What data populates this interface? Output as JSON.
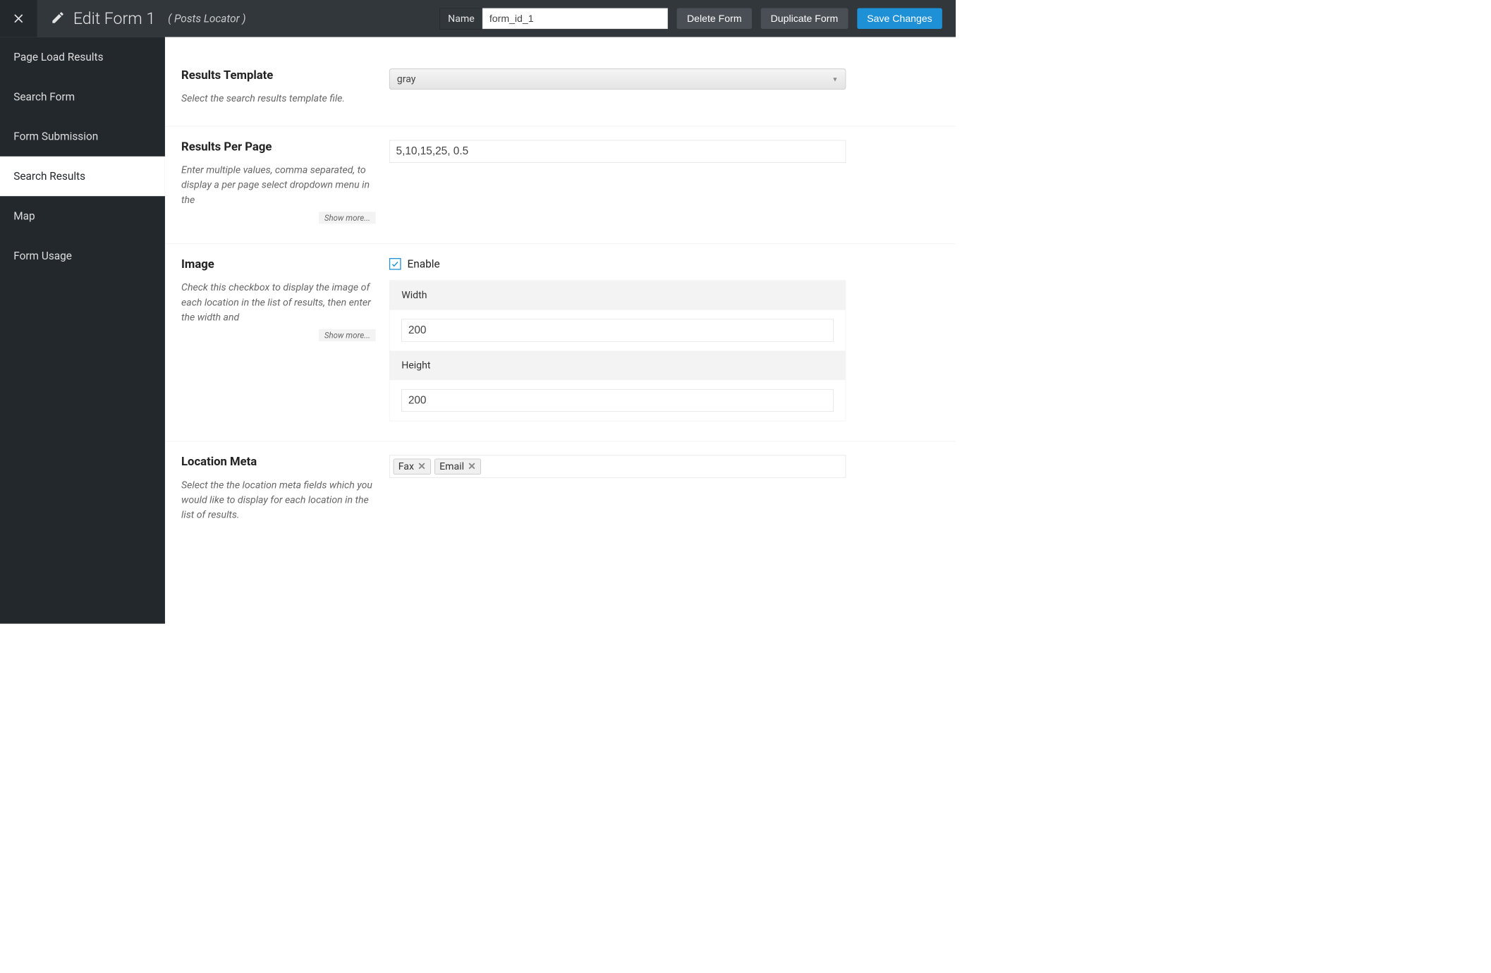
{
  "header": {
    "title": "Edit Form 1",
    "subtitle": "( Posts Locator )",
    "name_label": "Name",
    "name_value": "form_id_1",
    "delete_label": "Delete Form",
    "duplicate_label": "Duplicate Form",
    "save_label": "Save Changes"
  },
  "sidebar": {
    "items": [
      {
        "label": "Page Load Results"
      },
      {
        "label": "Search Form"
      },
      {
        "label": "Form Submission"
      },
      {
        "label": "Search Results"
      },
      {
        "label": "Map"
      },
      {
        "label": "Form Usage"
      }
    ]
  },
  "results_template": {
    "label": "Results Template",
    "desc": "Select the search results template file.",
    "value": "gray"
  },
  "results_per_page": {
    "label": "Results Per Page",
    "desc": "Enter multiple values, comma separated, to display a per page select dropdown menu in the",
    "show_more": "Show more...",
    "value": "5,10,15,25, 0.5"
  },
  "image": {
    "label": "Image",
    "desc": "Check this checkbox to display the image of each location in the list of results, then enter the width and",
    "show_more": "Show more...",
    "enable_label": "Enable",
    "enabled": true,
    "width_label": "Width",
    "width_value": "200",
    "height_label": "Height",
    "height_value": "200"
  },
  "location_meta": {
    "label": "Location Meta",
    "desc": "Select the the location meta fields which you would like to display for each location in the list of results.",
    "tags": [
      "Fax",
      "Email"
    ]
  }
}
